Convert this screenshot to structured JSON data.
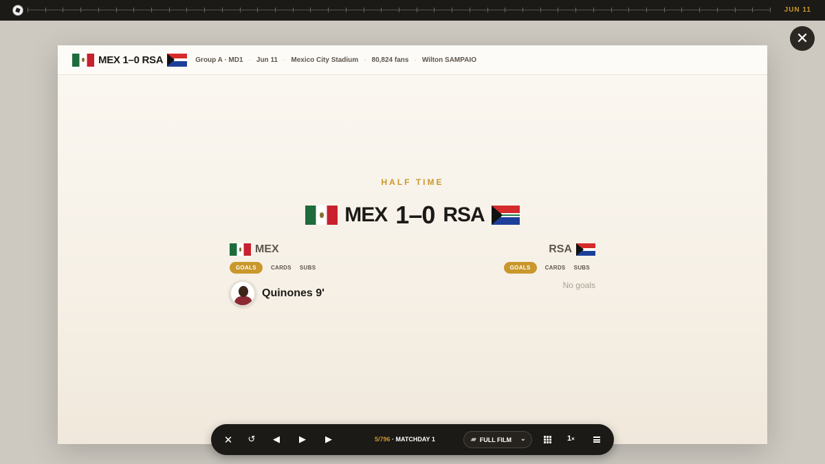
{
  "topbar": {
    "date": "JUN 11"
  },
  "header": {
    "home_code": "MEX",
    "score": "1–0",
    "away_code": "RSA",
    "group": "Group A · MD1",
    "date": "Jun 11",
    "stadium": "Mexico City Stadium",
    "attendance": "80,824 fans",
    "referee": "Wilton SAMPAIO"
  },
  "main": {
    "status": "HALF TIME",
    "home_code": "MEX",
    "score": "1–0",
    "away_code": "RSA"
  },
  "home": {
    "name": "MEX",
    "tabs": [
      "GOALS",
      "CARDS",
      "SUBS"
    ],
    "scorer": "Quinones 9'"
  },
  "away": {
    "name": "RSA",
    "tabs": [
      "GOALS",
      "CARDS",
      "SUBS"
    ],
    "empty": "No goals"
  },
  "controls": {
    "progress_current": "5/796",
    "progress_label": " · MATCHDAY 1",
    "view_mode": "FULL FILM",
    "speed": "1",
    "speed_suffix": "×",
    "icons": [
      "close-icon",
      "replay-icon",
      "prev-icon",
      "play-icon",
      "next-icon",
      "grid-icon",
      "menu-icon"
    ]
  },
  "colors": {
    "accent": "#c9972b",
    "dark": "#1c1a17",
    "background": "#cdc9c1"
  }
}
